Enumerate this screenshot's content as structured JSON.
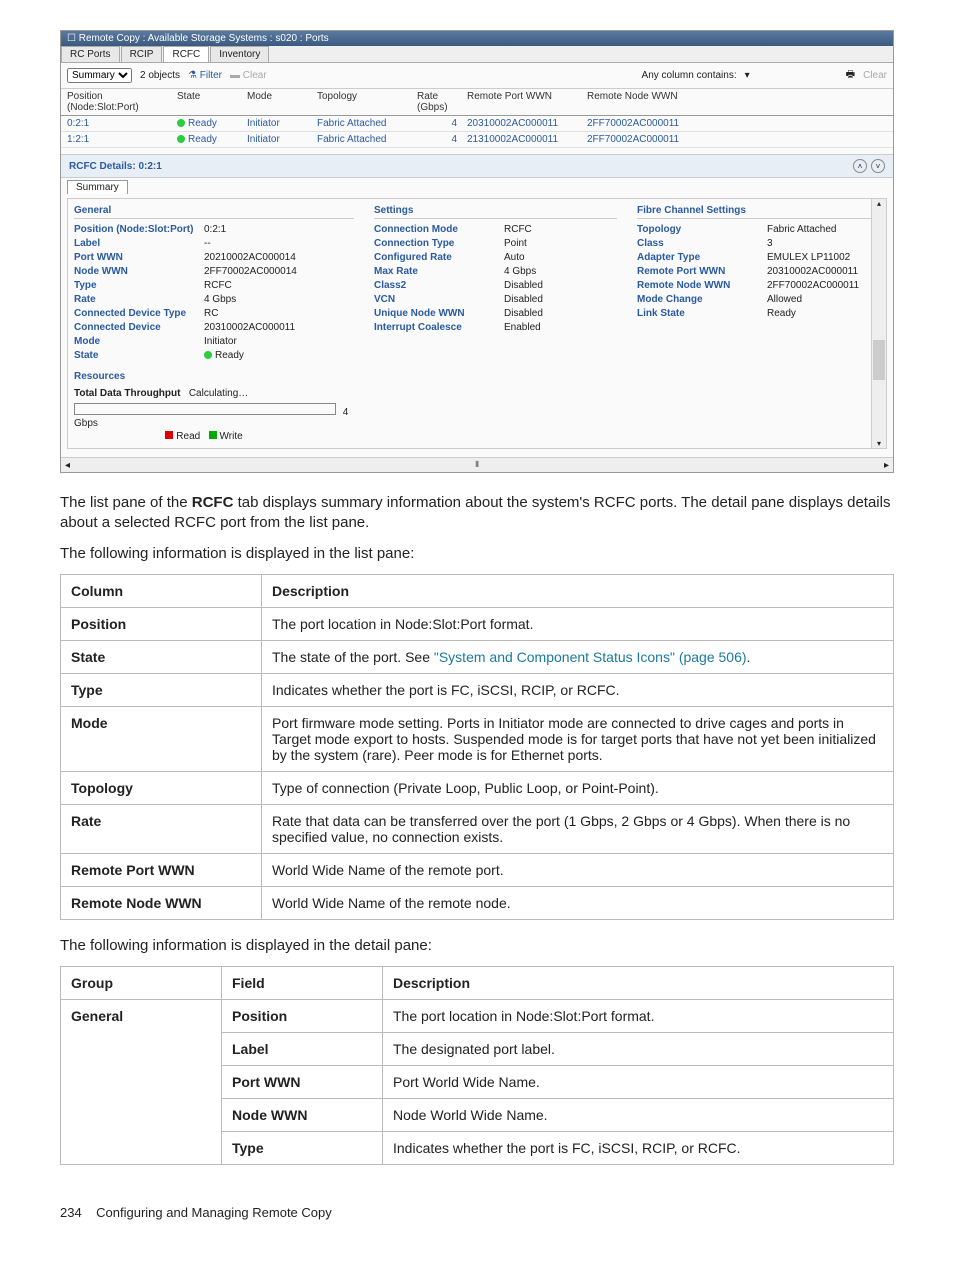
{
  "screenshot": {
    "titlebar": "Remote Copy : Available Storage Systems : s020 : Ports",
    "tabs": [
      "RC Ports",
      "RCIP",
      "RCFC",
      "Inventory"
    ],
    "active_tab": "RCFC",
    "toolbar": {
      "view_selector": "Summary",
      "object_count": "2 objects",
      "filter_label": "Filter",
      "clear_label": "Clear",
      "filter_prompt": "Any column contains:",
      "clear2": "Clear"
    },
    "list_header": [
      "Position (Node:Slot:Port)",
      "State",
      "Mode",
      "Topology",
      "Rate (Gbps)",
      "Remote Port WWN",
      "Remote Node WWN"
    ],
    "list_rows": [
      {
        "pos": "0:2:1",
        "state": "Ready",
        "mode": "Initiator",
        "topology": "Fabric Attached",
        "rate": "4",
        "rport": "20310002AC000011",
        "rnode": "2FF70002AC000011"
      },
      {
        "pos": "1:2:1",
        "state": "Ready",
        "mode": "Initiator",
        "topology": "Fabric Attached",
        "rate": "4",
        "rport": "21310002AC000011",
        "rnode": "2FF70002AC000011"
      }
    ],
    "detail_title": "RCFC Details: 0:2:1",
    "summary_tab": "Summary",
    "general": {
      "title": "General",
      "fields": {
        "Position (Node:Slot:Port)": "0:2:1",
        "Label": "--",
        "Port WWN": "20210002AC000014",
        "Node WWN": "2FF70002AC000014",
        "Type": "RCFC",
        "Rate": "4 Gbps",
        "Connected Device Type": "RC",
        "Connected Device": "20310002AC000011",
        "Mode": "Initiator",
        "State": "Ready"
      }
    },
    "resources": {
      "title": "Resources",
      "tdt_label": "Total Data Throughput",
      "tdt_value": "Calculating…",
      "bar_max": "4 Gbps",
      "legend_read": "Read",
      "legend_write": "Write"
    },
    "settings": {
      "title": "Settings",
      "fields": {
        "Connection Mode": "RCFC",
        "Connection Type": "Point",
        "Configured Rate": "Auto",
        "Max Rate": "4 Gbps",
        "Class2": "Disabled",
        "VCN": "Disabled",
        "Unique Node WWN": "Disabled",
        "Interrupt Coalesce": "Enabled"
      }
    },
    "fc": {
      "title": "Fibre Channel Settings",
      "fields": {
        "Topology": "Fabric Attached",
        "Class": "3",
        "Adapter Type": "EMULEX LP11002",
        "Remote Port WWN": "20310002AC000011",
        "Remote Node WWN": "2FF70002AC000011",
        "Mode Change": "Allowed",
        "Link State": "Ready"
      }
    }
  },
  "body": {
    "p1_a": "The list pane of the ",
    "p1_b": "RCFC",
    "p1_c": " tab displays summary information about the system's RCFC ports. The detail pane displays details about a selected RCFC port from the list pane.",
    "p2": "The following information is displayed in the list pane:",
    "table1_head": [
      "Column",
      "Description"
    ],
    "table1_rows": [
      {
        "c": "Position",
        "d": "The port location in Node:Slot:Port format."
      },
      {
        "c": "State",
        "d_pre": "The state of the port. See ",
        "d_link": "\"System and Component Status Icons\" (page 506)",
        "d_post": "."
      },
      {
        "c": "Type",
        "d": "Indicates whether the port is FC, iSCSI, RCIP, or RCFC."
      },
      {
        "c": "Mode",
        "d": "Port firmware mode setting. Ports in Initiator mode are connected to drive cages and ports in Target mode export to hosts. Suspended mode is for target ports that have not yet been initialized by the system (rare). Peer mode is for Ethernet ports."
      },
      {
        "c": "Topology",
        "d": "Type of connection (Private Loop, Public Loop, or Point-Point)."
      },
      {
        "c": "Rate",
        "d": "Rate that data can be transferred over the port (1 Gbps, 2 Gbps or 4 Gbps). When there is no specified value, no connection exists."
      },
      {
        "c": "Remote Port WWN",
        "d": "World Wide Name of the remote port."
      },
      {
        "c": "Remote Node WWN",
        "d": "World Wide Name of the remote node."
      }
    ],
    "p3": "The following information is displayed in the detail pane:",
    "table2_head": [
      "Group",
      "Field",
      "Description"
    ],
    "table2_group": "General",
    "table2_rows": [
      {
        "f": "Position",
        "d": "The port location in Node:Slot:Port format."
      },
      {
        "f": "Label",
        "d": "The designated port label."
      },
      {
        "f": "Port WWN",
        "d": "Port World Wide Name."
      },
      {
        "f": "Node WWN",
        "d": "Node World Wide Name."
      },
      {
        "f": "Type",
        "d": "Indicates whether the port is FC, iSCSI, RCIP, or RCFC."
      }
    ]
  },
  "footer": {
    "page": "234",
    "section": "Configuring and Managing Remote Copy"
  }
}
